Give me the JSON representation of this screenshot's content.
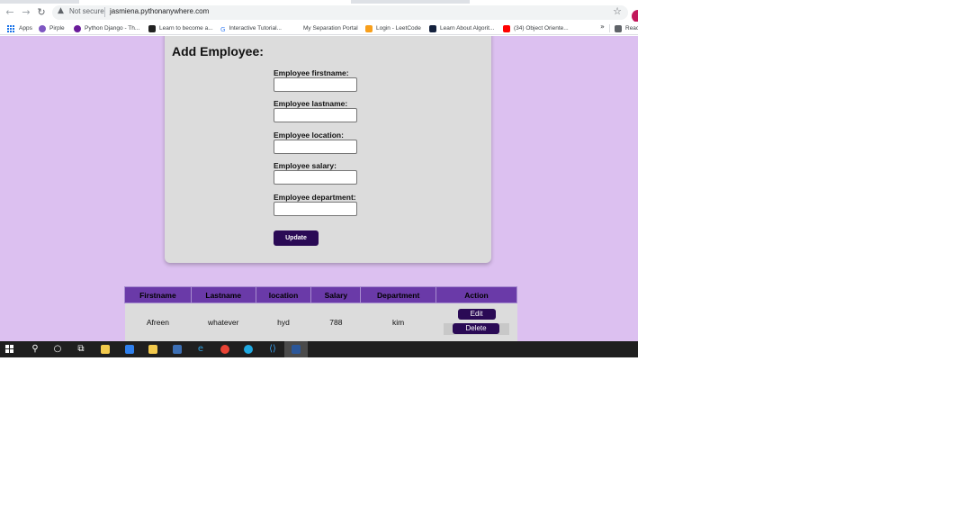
{
  "browser": {
    "security_label": "Not secure",
    "url": "jasmiena.pythonanywhere.com",
    "bookmarks": [
      {
        "label": "Apps",
        "icon": "apps-grid-icon"
      },
      {
        "label": "Pirple",
        "icon": "pirple-icon",
        "color": "#7e57c2"
      },
      {
        "label": "Python Django - Th...",
        "icon": "django-icon",
        "color": "#6a1b9a"
      },
      {
        "label": "Learn to become a...",
        "icon": "freecodecamp-icon",
        "color": "#222222"
      },
      {
        "label": "Interactive Tutorial...",
        "icon": "google-icon"
      },
      {
        "label": "My Separation Portal",
        "icon": "blank-icon",
        "color": "#ffffff"
      },
      {
        "label": "Login - LeetCode",
        "icon": "leetcode-icon",
        "color": "#f89f1b"
      },
      {
        "label": "Learn About Algorit...",
        "icon": "khan-icon",
        "color": "#14213d"
      },
      {
        "label": "(34) Object Oriente...",
        "icon": "youtube-icon",
        "color": "#ff0000"
      },
      {
        "label": "Reac",
        "icon": "reading-list-icon",
        "color": "#5f6368"
      }
    ],
    "more_label": "»"
  },
  "form": {
    "title": "Add Employee:",
    "fields": [
      {
        "label": "Employee firstname:",
        "value": ""
      },
      {
        "label": "Employee lastname:",
        "value": ""
      },
      {
        "label": "Employee location:",
        "value": ""
      },
      {
        "label": "Employee salary:",
        "value": ""
      },
      {
        "label": "Employee department:",
        "value": ""
      }
    ],
    "submit_label": "Update"
  },
  "table": {
    "headers": [
      "Firstname",
      "Lastname",
      "location",
      "Salary",
      "Department",
      "Action"
    ],
    "rows": [
      {
        "firstname": "Afreen",
        "lastname": "whatever",
        "location": "hyd",
        "salary": "788",
        "department": "kim",
        "edit_label": "Edit",
        "delete_label": "Delete"
      }
    ]
  },
  "colors": {
    "page_bg": "#dcc0f0",
    "card_bg": "#dcdcdc",
    "header_bg": "#6a3aa8",
    "button_bg": "#2a0a55"
  }
}
